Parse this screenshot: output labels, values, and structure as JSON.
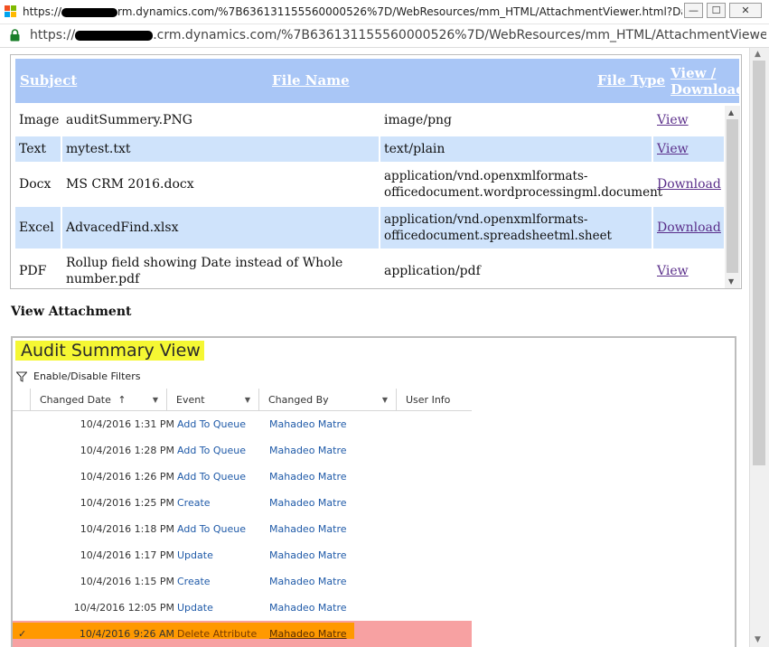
{
  "window": {
    "title_prefix": "https://",
    "title_suffix": "rm.dynamics.com/%7B636131155560000526%7D/WebResources/mm_HTML/AttachmentViewer.html?Data=recor...",
    "minimize": "—",
    "maximize": "☐",
    "close": "✕",
    "address_prefix": "https://",
    "address_suffix": ".crm.dynamics.com/%7B636131155560000526%7D/WebResources/mm_HTML/AttachmentViewer.html?Data=re"
  },
  "attachments": {
    "headers": {
      "subject": "Subject",
      "file_name": "File Name",
      "file_type": "File Type",
      "view_download_1": "View /",
      "view_download_2": "Download"
    },
    "rows": [
      {
        "subject": "Image",
        "file_name": "auditSummery.PNG",
        "file_type": "image/png",
        "action": "View"
      },
      {
        "subject": "Text",
        "file_name": "mytest.txt",
        "file_type": "text/plain",
        "action": "View"
      },
      {
        "subject": "Docx",
        "file_name": "MS CRM 2016.docx",
        "file_type": "application/vnd.openxmlformats-officedocument.wordprocessingml.document",
        "action": "Download"
      },
      {
        "subject": "Excel",
        "file_name": "AdvacedFind.xlsx",
        "file_type": "application/vnd.openxmlformats-officedocument.spreadsheetml.sheet",
        "action": "Download"
      },
      {
        "subject": "PDF",
        "file_name": "Rollup field showing Date instead of Whole number.pdf",
        "file_type": "application/pdf",
        "action": "View"
      }
    ]
  },
  "view_attachment_title": "View Attachment",
  "audit": {
    "title": "Audit Summary View",
    "filter_label": "Enable/Disable Filters",
    "columns": {
      "changed_date": "Changed Date",
      "event": "Event",
      "changed_by": "Changed By",
      "user_info": "User Info"
    },
    "sort_arrow": "↑",
    "dropdown": "▼",
    "rows": [
      {
        "date": "10/4/2016 1:31 PM",
        "event": "Add To Queue",
        "by": "Mahadeo Matre"
      },
      {
        "date": "10/4/2016 1:28 PM",
        "event": "Add To Queue",
        "by": "Mahadeo Matre"
      },
      {
        "date": "10/4/2016 1:26 PM",
        "event": "Add To Queue",
        "by": "Mahadeo Matre"
      },
      {
        "date": "10/4/2016 1:25 PM",
        "event": "Create",
        "by": "Mahadeo Matre"
      },
      {
        "date": "10/4/2016 1:18 PM",
        "event": "Add To Queue",
        "by": "Mahadeo Matre"
      },
      {
        "date": "10/4/2016 1:17 PM",
        "event": "Update",
        "by": "Mahadeo Matre"
      },
      {
        "date": "10/4/2016 1:15 PM",
        "event": "Create",
        "by": "Mahadeo Matre"
      },
      {
        "date": "10/4/2016 12:05 PM",
        "event": "Update",
        "by": "Mahadeo Matre"
      },
      {
        "date": "10/4/2016 9:26 AM",
        "event": "Delete Attribute",
        "by": "Mahadeo Matre"
      }
    ],
    "selected_check": "✓"
  },
  "colors": {
    "header_blue": "#a9c6f6",
    "row_shade": "#cfe3fb",
    "highlight_yellow": "#f5f733",
    "selected_row": "#f7a1a2",
    "selected_orange": "#ff9900",
    "link_blue": "#1f5aa8"
  }
}
